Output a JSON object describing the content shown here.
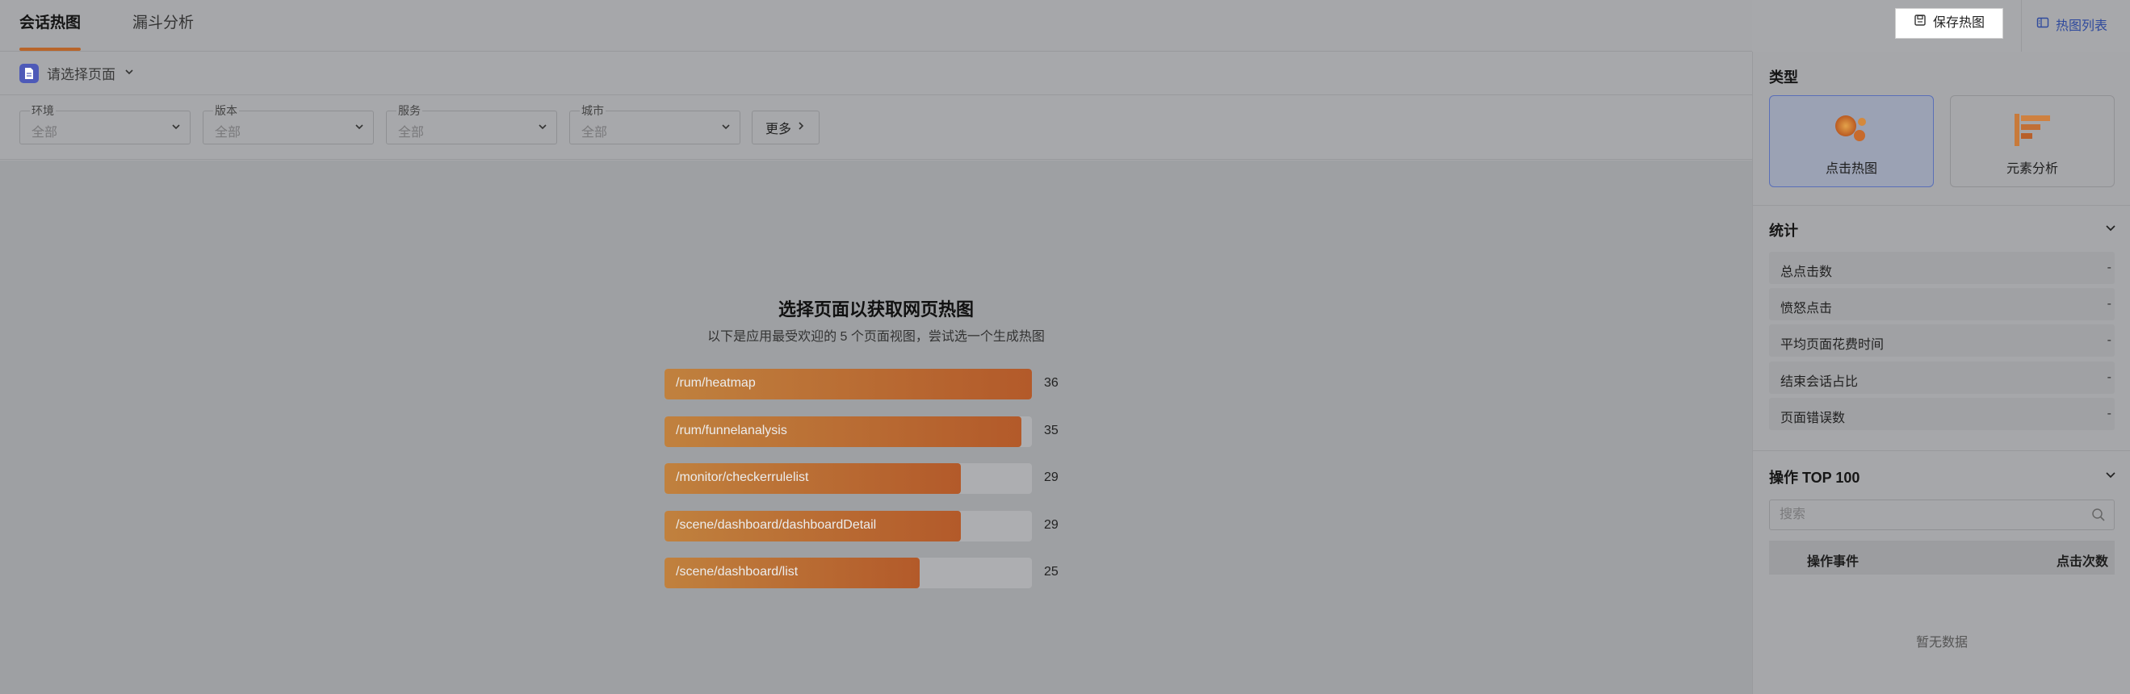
{
  "header": {
    "tabs": [
      {
        "label": "会话热图",
        "active": true
      },
      {
        "label": "漏斗分析",
        "active": false
      }
    ],
    "save_button": "保存热图",
    "heatmap_list": "热图列表",
    "accent_color": "#b8652a"
  },
  "page_selector": {
    "placeholder": "请选择页面"
  },
  "filters": [
    {
      "label": "环境",
      "value": "全部"
    },
    {
      "label": "版本",
      "value": "全部"
    },
    {
      "label": "服务",
      "value": "全部"
    },
    {
      "label": "城市",
      "value": "全部"
    }
  ],
  "more_button": "更多",
  "main": {
    "title": "选择页面以获取网页热图",
    "subtitle": "以下是应用最受欢迎的 5 个页面视图，尝试选一个生成热图",
    "pages": [
      {
        "path": "/rum/heatmap",
        "count": 36
      },
      {
        "path": "/rum/funnelanalysis",
        "count": 35
      },
      {
        "path": "/monitor/checkerrulelist",
        "count": 29
      },
      {
        "path": "/scene/dashboard/dashboardDetail",
        "count": 29
      },
      {
        "path": "/scene/dashboard/list",
        "count": 25
      }
    ]
  },
  "panel": {
    "type_title": "类型",
    "types": [
      {
        "label": "点击热图",
        "selected": true,
        "icon": "click-heatmap-icon"
      },
      {
        "label": "元素分析",
        "selected": false,
        "icon": "element-analysis-icon"
      }
    ],
    "stats_title": "统计",
    "stats": [
      {
        "label": "总点击数",
        "value": "-"
      },
      {
        "label": "愤怒点击",
        "value": "-"
      },
      {
        "label": "平均页面花费时间",
        "value": "-"
      },
      {
        "label": "结束会话占比",
        "value": "-"
      },
      {
        "label": "页面错误数",
        "value": "-"
      }
    ],
    "ops_title": "操作 TOP 100",
    "search_placeholder": "搜索",
    "table_headers": [
      "操作事件",
      "点击次数"
    ],
    "empty_text": "暂无数据"
  }
}
